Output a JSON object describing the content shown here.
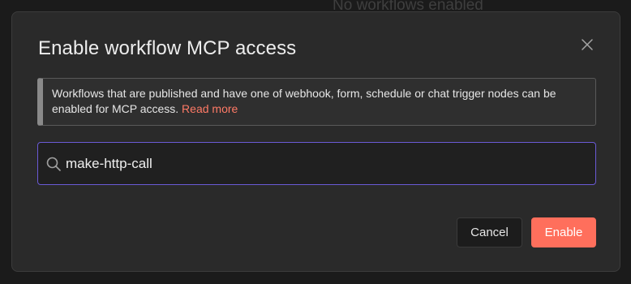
{
  "background": {
    "empty_state_text": "No workflows enabled"
  },
  "dialog": {
    "title": "Enable workflow MCP access",
    "close_icon": "close-icon",
    "callout": {
      "text": "Workflows that are published and have one of webhook, form, schedule or chat trigger nodes can be enabled for MCP access.",
      "link_label": "Read more"
    },
    "search": {
      "icon": "search-icon",
      "value": "make-http-call",
      "placeholder": ""
    },
    "buttons": {
      "cancel_label": "Cancel",
      "enable_label": "Enable"
    }
  },
  "colors": {
    "accent": "#ff6f5c",
    "link": "#ff7a66",
    "focus_border": "#6a5ad6",
    "modal_bg": "#2a2a2a"
  }
}
